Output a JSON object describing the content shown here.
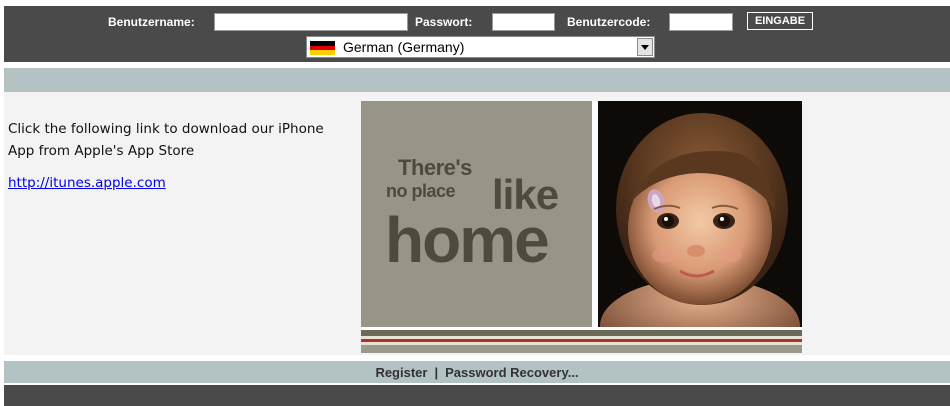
{
  "colors": {
    "dark_bar": "#4a4a4a",
    "teal_strip": "#b3c3c3",
    "content_bg": "#f3f3f3",
    "banner_left": "#989488",
    "slogan": "#4c4b3e",
    "link": "#0000ee"
  },
  "login": {
    "username_label": "Benutzername:",
    "username_value": "",
    "password_label": "Passwort:",
    "password_value": "",
    "usercode_label": "Benutzercode:",
    "usercode_value": "",
    "submit_label": "EINGABE"
  },
  "language_select": {
    "selected": "German (Germany)",
    "flag_icon": "german-flag-icon",
    "dropdown_icon": "chevron-down-icon"
  },
  "main": {
    "info_text": "Click the following link to download our iPhone App from Apple's App Store",
    "app_link": "http://itunes.apple.com"
  },
  "banner": {
    "line1": "There's",
    "line2": "no place",
    "line3": "like",
    "line4": "home"
  },
  "footer": {
    "register": "Register",
    "separator": "|",
    "password_recovery": "Password Recovery..."
  }
}
